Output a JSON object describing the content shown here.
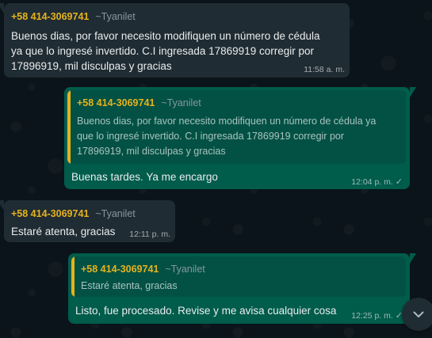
{
  "messages": [
    {
      "type": "incoming",
      "sender_phone": "+58 414-3069741",
      "sender_name": "~Tyanilet",
      "lines": [
        "Buenos dias, por favor necesito  modifiquen un número de cédula",
        "ya que lo ingresé invertido.  C.I ingresada 17869919 corregir por",
        "17896919, mil disculpas y gracias"
      ],
      "time": "11:58 a. m."
    },
    {
      "type": "outgoing",
      "quote": {
        "sender_phone": "+58 414-3069741",
        "sender_name": "~Tyanilet",
        "lines": [
          "Buenos dias, por favor necesito  modifiquen un número de cédula ya",
          "que lo ingresé invertido.  C.I ingresada 17869919 corregir por",
          "17896919, mil disculpas y gracias"
        ]
      },
      "text": "Buenas tardes. Ya me encargo",
      "time": "12:04 p. m."
    },
    {
      "type": "incoming",
      "sender_phone": "+58 414-3069741",
      "sender_name": "~Tyanilet",
      "text": "Estaré  atenta, gracias",
      "time": "12:11 p. m."
    },
    {
      "type": "outgoing",
      "quote": {
        "sender_phone": "+58 414-3069741",
        "sender_name": "~Tyanilet",
        "text": "Estaré  atenta, gracias"
      },
      "text": "Listo, fue procesado. Revise y me avisa cualquier cosa",
      "time": "12:25 p. m."
    }
  ],
  "icons": {
    "delivered": "check-icon",
    "scroll_down": "chevron-down-icon"
  },
  "colors": {
    "chat_background": "#0b141a",
    "incoming_bubble": "#202c33",
    "outgoing_bubble": "#005c4b",
    "sender_accent": "#e5b21e"
  }
}
